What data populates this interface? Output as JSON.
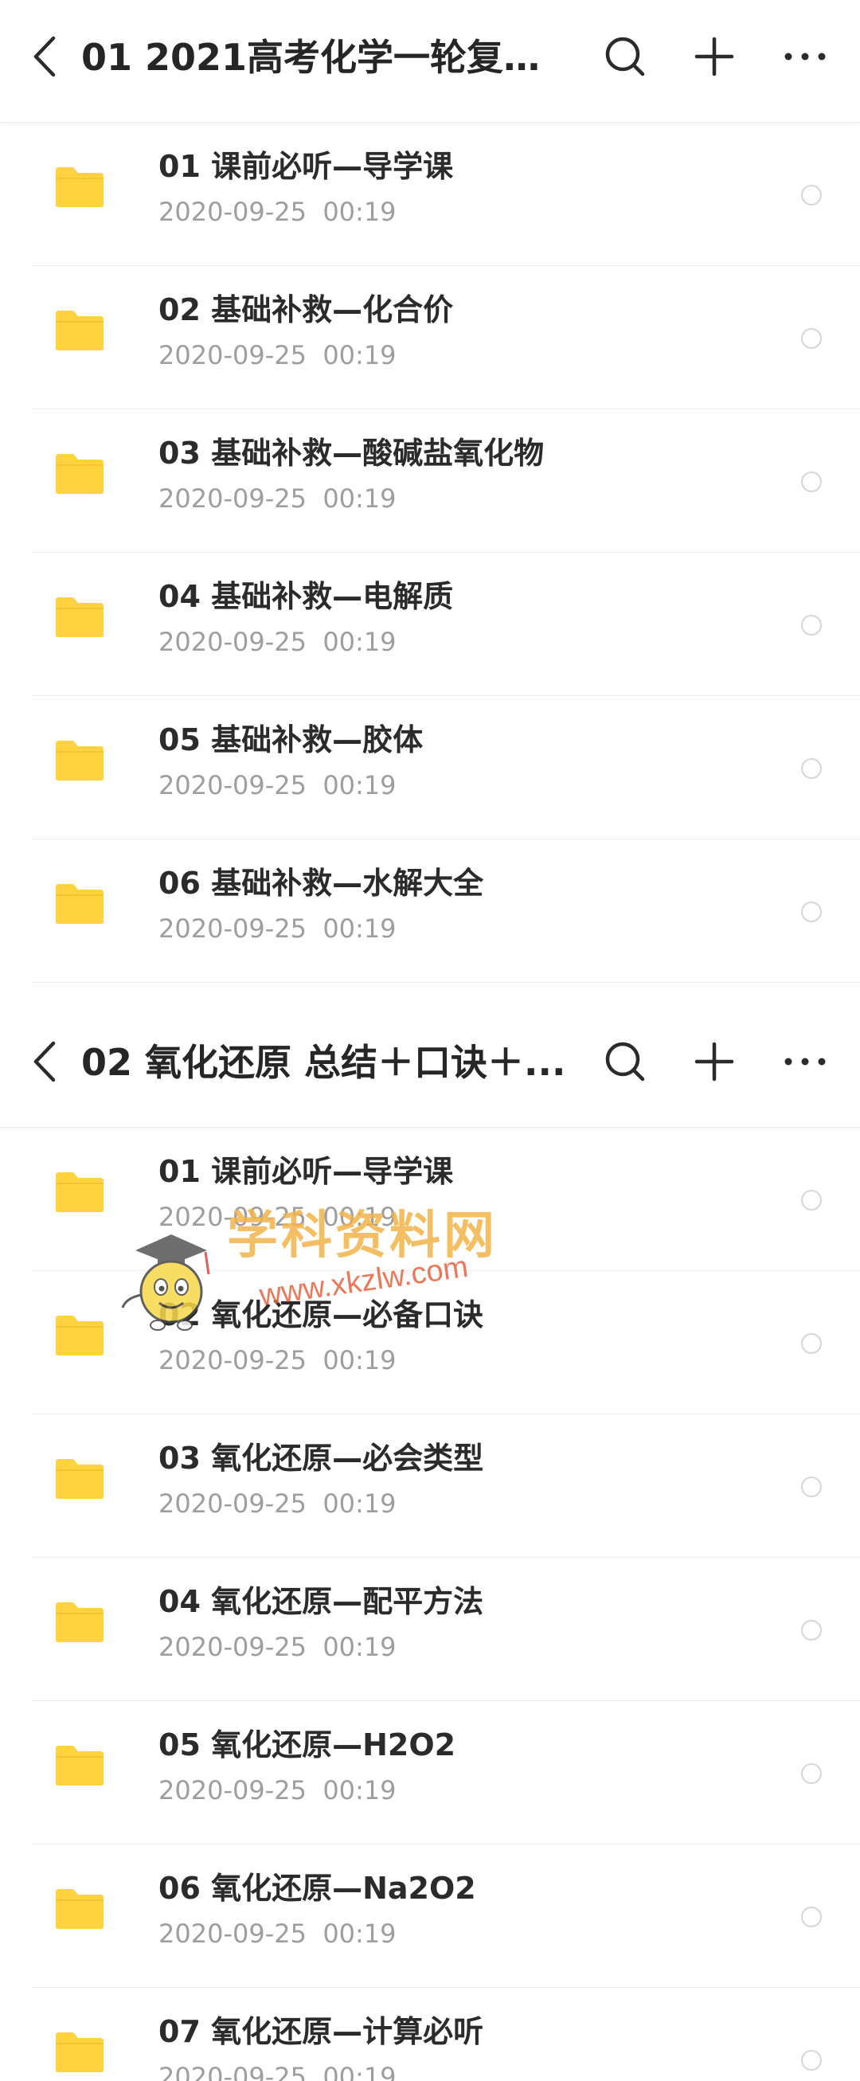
{
  "screens": [
    {
      "title": "01 2021高考化学一轮复习...",
      "items": [
        {
          "name": "01 课前必听—导学课",
          "date": "2020-09-25  00:19"
        },
        {
          "name": "02 基础补救—化合价",
          "date": "2020-09-25  00:19"
        },
        {
          "name": "03 基础补救—酸碱盐氧化物",
          "date": "2020-09-25  00:19"
        },
        {
          "name": "04 基础补救—电解质",
          "date": "2020-09-25  00:19"
        },
        {
          "name": "05 基础补救—胶体",
          "date": "2020-09-25  00:19"
        },
        {
          "name": "06 基础补救—水解大全",
          "date": "2020-09-25  00:19"
        }
      ]
    },
    {
      "title": "02 氧化还原  总结＋口诀＋...",
      "items": [
        {
          "name": "01 课前必听—导学课",
          "date": "2020-09-25  00:19"
        },
        {
          "name": "02 氧化还原—必备口诀",
          "date": "2020-09-25  00:19"
        },
        {
          "name": "03 氧化还原—必会类型",
          "date": "2020-09-25  00:19"
        },
        {
          "name": "04 氧化还原—配平方法",
          "date": "2020-09-25  00:19"
        },
        {
          "name": "05 氧化还原—H2O2",
          "date": "2020-09-25  00:19"
        },
        {
          "name": "06 氧化还原—Na2O2",
          "date": "2020-09-25  00:19"
        },
        {
          "name": "07 氧化还原—计算必听",
          "date": "2020-09-25  00:19"
        }
      ]
    }
  ],
  "watermark": {
    "text": "学科资料网",
    "url": "www.xkzlw.com"
  },
  "icons": {
    "back": "chevron-left-icon",
    "search": "search-icon",
    "add": "plus-icon",
    "more": "more-horizontal-icon",
    "folder": "folder-icon"
  },
  "colors": {
    "folder": "#FFD23F",
    "date": "#9E9E9E",
    "text": "#262626"
  }
}
